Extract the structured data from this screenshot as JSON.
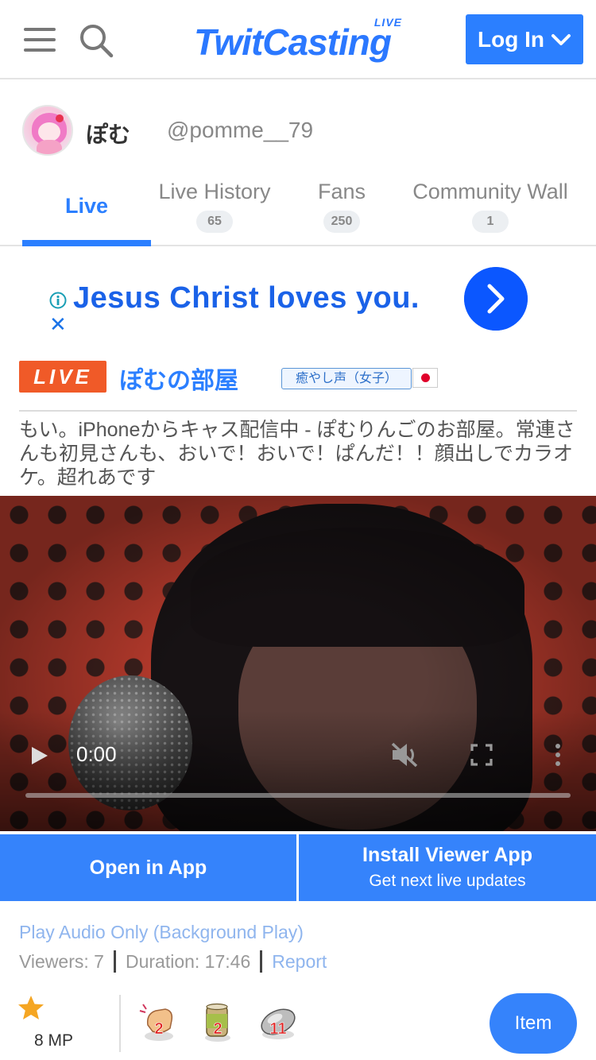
{
  "header": {
    "logo_text": "TwitCasting",
    "logo_badge": "LIVE",
    "login_label": "Log In",
    "brand_color": "#2b7fff"
  },
  "profile": {
    "name": "ぽむ",
    "handle": "@pomme__79"
  },
  "tabs": [
    {
      "label": "Live",
      "count": null,
      "active": true
    },
    {
      "label": "Live History",
      "count": "65",
      "active": false
    },
    {
      "label": "Fans",
      "count": "250",
      "active": false
    },
    {
      "label": "Community Wall",
      "count": "1",
      "active": false
    }
  ],
  "ad": {
    "text": "Jesus Christ loves you.",
    "close_symbol": "✕"
  },
  "live": {
    "badge": "LIVE",
    "title": "ぽむの部屋",
    "category": "癒やし声（女子）",
    "description": "もい。iPhoneからキャス配信中 - ぽむりんごのお部屋。常連さんも初見さんも、おいで！おいで！ぱんだ！！顔出しでカラオケ。超れあです",
    "live_color": "#f05a28"
  },
  "video": {
    "time": "0:00"
  },
  "buttons": {
    "open_app": "Open in App",
    "install_title": "Install Viewer App",
    "install_sub": "Get next live updates"
  },
  "info": {
    "audio_only": "Play Audio Only (Background Play)",
    "viewers": "Viewers: 7",
    "duration": "Duration: 17:46",
    "report": "Report"
  },
  "items": {
    "mp": "8 MP",
    "gifts": [
      {
        "icon": "clap-icon",
        "count": "2"
      },
      {
        "icon": "tea-can-icon",
        "count": "2"
      },
      {
        "icon": "pill-capsule-icon",
        "count": "11"
      }
    ],
    "item_button": "Item"
  }
}
